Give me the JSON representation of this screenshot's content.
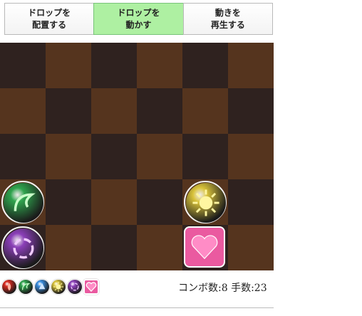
{
  "tabs": [
    {
      "label": "ドロップを\n配置する",
      "active": false
    },
    {
      "label": "ドロップを\n動かす",
      "active": true
    },
    {
      "label": "動きを\n再生する",
      "active": false
    }
  ],
  "board": {
    "cols": 6,
    "rows": 5,
    "orbs": [
      {
        "row": 3,
        "col": 0,
        "type": "wood"
      },
      {
        "row": 3,
        "col": 4,
        "type": "light"
      },
      {
        "row": 4,
        "col": 0,
        "type": "dark"
      },
      {
        "row": 4,
        "col": 4,
        "type": "heart"
      }
    ]
  },
  "orb_palette": [
    "fire",
    "wood",
    "water",
    "light",
    "dark",
    "heart"
  ],
  "colors": {
    "fire": "#d62a1e",
    "wood": "#2fa34d",
    "water": "#3b8fe0",
    "light": "#d9c33a",
    "dark": "#8b3fb8",
    "heart": "#ea5aa0"
  },
  "status": {
    "combo": "コンボ数:8",
    "moves": "手数:23"
  }
}
